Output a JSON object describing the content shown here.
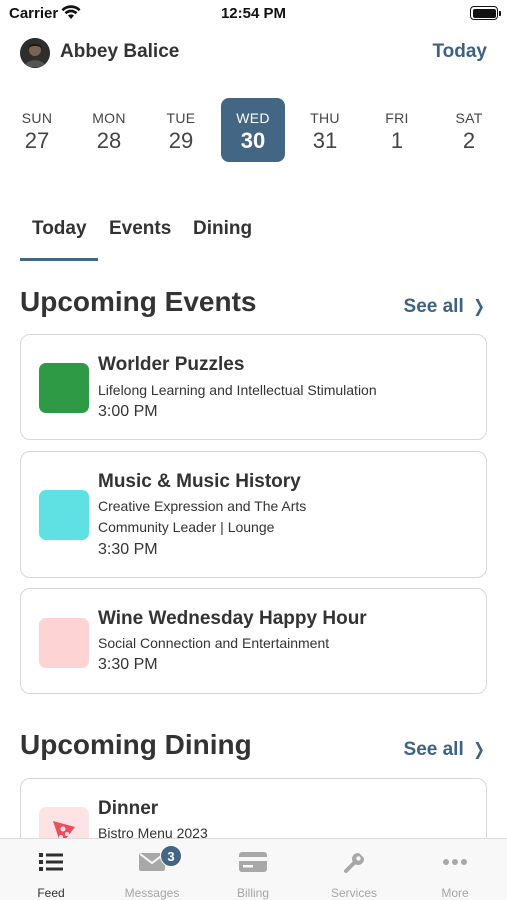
{
  "status_bar": {
    "carrier": "Carrier",
    "time": "12:54 PM"
  },
  "header": {
    "user_name": "Abbey Balice",
    "today_label": "Today"
  },
  "week": [
    {
      "dow": "SUN",
      "num": "27",
      "selected": false
    },
    {
      "dow": "MON",
      "num": "28",
      "selected": false
    },
    {
      "dow": "TUE",
      "num": "29",
      "selected": false
    },
    {
      "dow": "WED",
      "num": "30",
      "selected": true
    },
    {
      "dow": "THU",
      "num": "31",
      "selected": false
    },
    {
      "dow": "FRI",
      "num": "1",
      "selected": false
    },
    {
      "dow": "SAT",
      "num": "2",
      "selected": false
    }
  ],
  "tabs": [
    {
      "label": "Today",
      "active": true
    },
    {
      "label": "Events",
      "active": false
    },
    {
      "label": "Dining",
      "active": false
    }
  ],
  "upcoming_events": {
    "title": "Upcoming Events",
    "see_all": "See all",
    "items": [
      {
        "title": "Worlder Puzzles",
        "category": "Lifelong Learning and Intellectual Stimulation",
        "location": "",
        "time": "3:00 PM",
        "color": "#2f9a45"
      },
      {
        "title": "Music & Music History",
        "category": "Creative Expression and The Arts",
        "location": "Community Leader | Lounge",
        "time": "3:30 PM",
        "color": "#5fe0e3"
      },
      {
        "title": "Wine Wednesday Happy Hour",
        "category": "Social Connection and Entertainment",
        "location": "",
        "time": "3:30 PM",
        "color": "#fdd3d3"
      }
    ]
  },
  "upcoming_dining": {
    "title": "Upcoming Dining",
    "see_all": "See all",
    "items": [
      {
        "title": "Dinner",
        "subtitle": "Bistro Menu 2023",
        "icon": "pizza-icon",
        "color": "#e8505b"
      }
    ]
  },
  "tab_bar": {
    "items": [
      {
        "label": "Feed",
        "icon": "list-icon",
        "active": true
      },
      {
        "label": "Messages",
        "icon": "envelope-icon",
        "active": false,
        "badge": "3"
      },
      {
        "label": "Billing",
        "icon": "credit-card-icon",
        "active": false
      },
      {
        "label": "Services",
        "icon": "wrench-icon",
        "active": false
      },
      {
        "label": "More",
        "icon": "ellipsis-icon",
        "active": false
      }
    ]
  }
}
